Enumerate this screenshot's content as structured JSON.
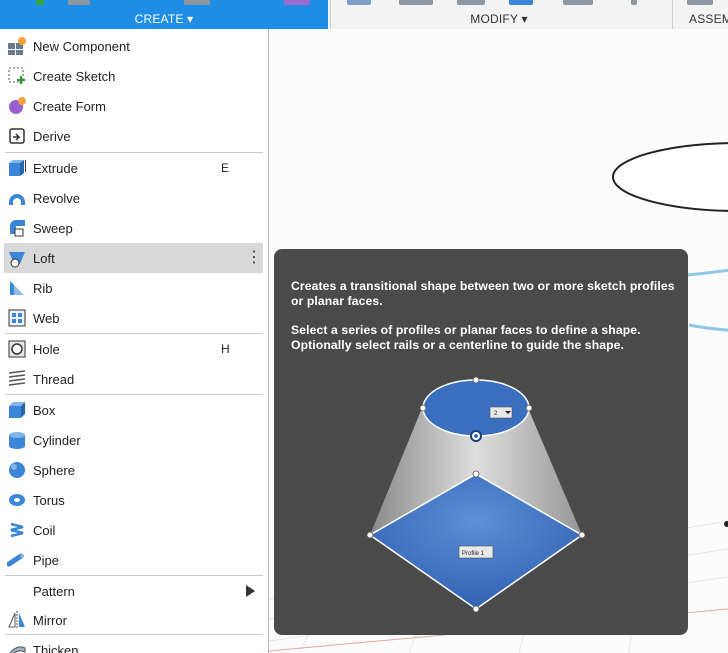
{
  "toolbar": {
    "create_label": "CREATE ▾",
    "modify_label": "MODIFY ▾",
    "assemble_label": "ASSEM"
  },
  "menu": {
    "items": [
      {
        "label": "New Component",
        "icon": "new-component-icon"
      },
      {
        "label": "Create Sketch",
        "icon": "create-sketch-icon"
      },
      {
        "label": "Create Form",
        "icon": "create-form-icon"
      },
      {
        "label": "Derive",
        "icon": "derive-icon"
      },
      {
        "label": "Extrude",
        "icon": "extrude-icon",
        "shortcut": "E"
      },
      {
        "label": "Revolve",
        "icon": "revolve-icon"
      },
      {
        "label": "Sweep",
        "icon": "sweep-icon"
      },
      {
        "label": "Loft",
        "icon": "loft-icon",
        "highlighted": true
      },
      {
        "label": "Rib",
        "icon": "rib-icon"
      },
      {
        "label": "Web",
        "icon": "web-icon"
      },
      {
        "label": "Hole",
        "icon": "hole-icon",
        "shortcut": "H"
      },
      {
        "label": "Thread",
        "icon": "thread-icon"
      },
      {
        "label": "Box",
        "icon": "box-icon"
      },
      {
        "label": "Cylinder",
        "icon": "cylinder-icon"
      },
      {
        "label": "Sphere",
        "icon": "sphere-icon"
      },
      {
        "label": "Torus",
        "icon": "torus-icon"
      },
      {
        "label": "Coil",
        "icon": "coil-icon"
      },
      {
        "label": "Pipe",
        "icon": "pipe-icon"
      },
      {
        "label": "Pattern",
        "icon": "",
        "submenu": true
      },
      {
        "label": "Mirror",
        "icon": "mirror-icon"
      },
      {
        "label": "Thicken",
        "icon": "thicken-icon"
      }
    ]
  },
  "tooltip": {
    "paragraph1": "Creates a transitional shape between two or more sketch profiles or planar faces.",
    "paragraph2": "Select a series of profiles or planar faces to define a shape. Optionally select rails or a centerline to guide the shape.",
    "profile_tag": "Profile 1",
    "dropdown_value": "2"
  },
  "colors": {
    "accent": "#1f8ee6",
    "tooltip_bg": "#4a4a4a",
    "highlight": "#d9d9d9",
    "profile_blue": "#3a6fc0"
  }
}
